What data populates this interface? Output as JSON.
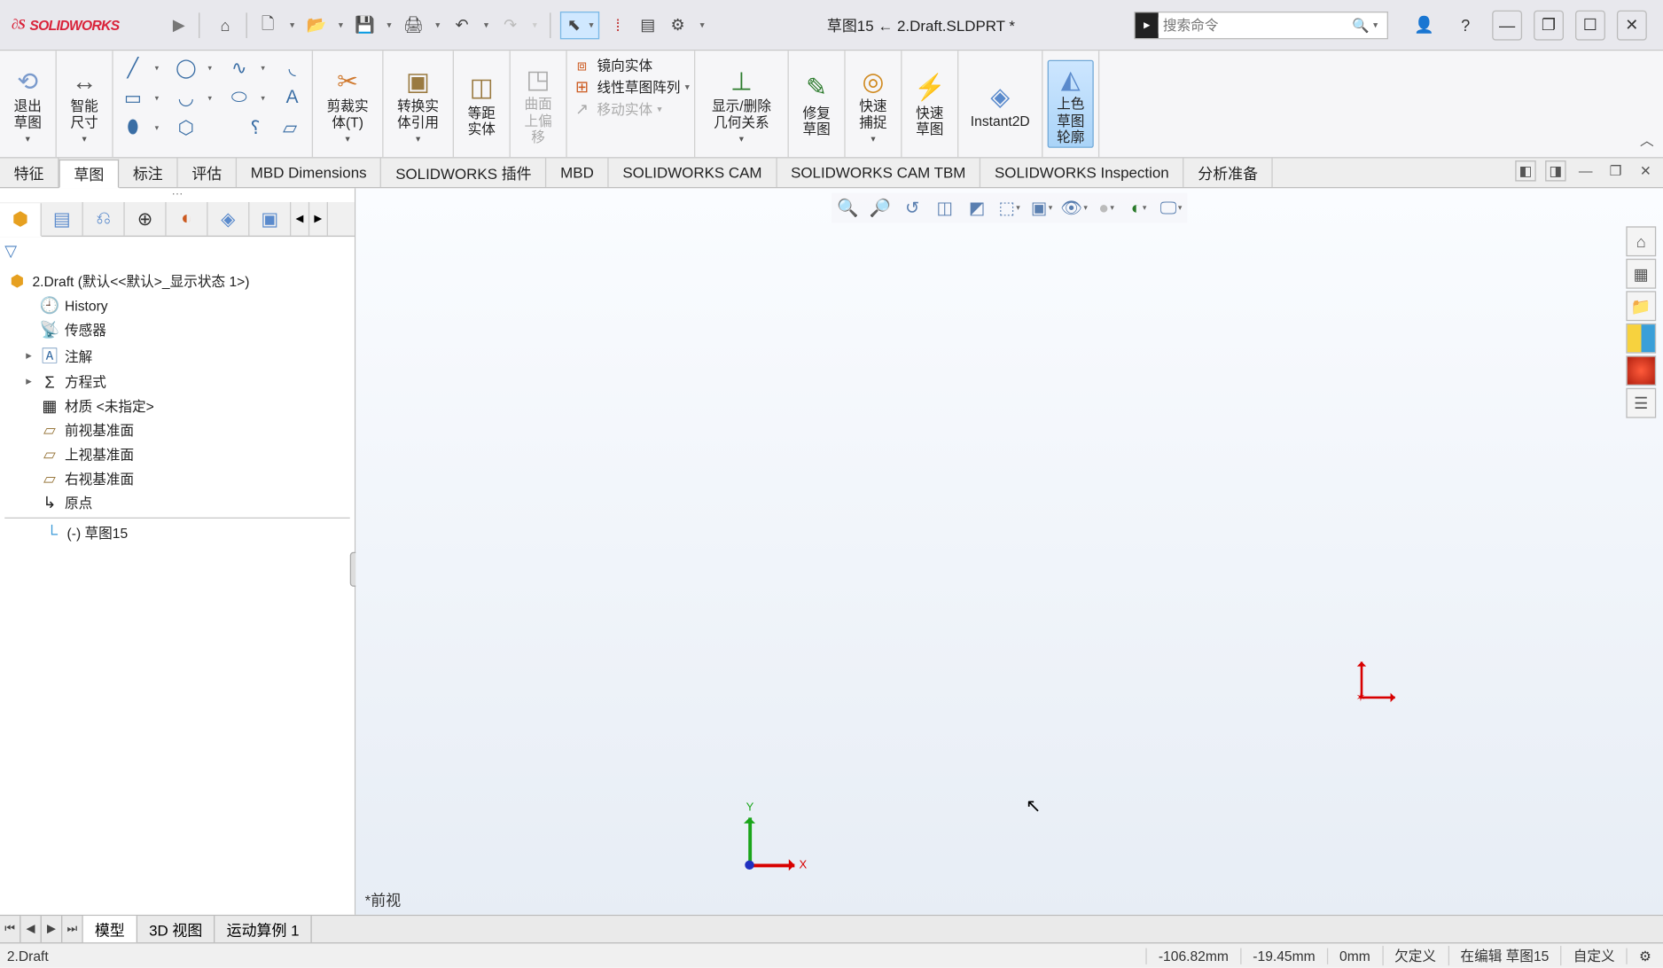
{
  "titlebar": {
    "logo_text": "SOLIDWORKS",
    "doc_title": "草图15 ← 2.Draft.SLDPRT *",
    "search_placeholder": "搜索命令"
  },
  "ribbon": {
    "exit_sketch": "退出\n草图",
    "smart_dim": "智能\n尺寸",
    "trim": "剪裁实\n体(T)",
    "convert": "转换实\n体引用",
    "offset": "等距\n实体",
    "surface_offset": "曲面\n上偏\n移",
    "mirror": "镜向实体",
    "linear_pattern": "线性草图阵列",
    "move": "移动实体",
    "show_del_rel": "显示/删除\n几何关系",
    "repair_sketch": "修复\n草图",
    "quick_snap": "快速\n捕捉",
    "quick_sketch": "快速\n草图",
    "instant2d": "Instant2D",
    "shade_outline": "上色\n草图\n轮廓"
  },
  "cm_tabs": [
    "特征",
    "草图",
    "标注",
    "评估",
    "MBD Dimensions",
    "SOLIDWORKS 插件",
    "MBD",
    "SOLIDWORKS CAM",
    "SOLIDWORKS CAM TBM",
    "SOLIDWORKS Inspection",
    "分析准备"
  ],
  "cm_active_index": 1,
  "tree": {
    "root": "2.Draft  (默认<<默认>_显示状态 1>)",
    "items": [
      {
        "icon": "🕘",
        "label": "History"
      },
      {
        "icon": "📡",
        "label": "传感器"
      },
      {
        "icon": "🄰",
        "label": "注解",
        "expandable": true
      },
      {
        "icon": "Σ",
        "label": "方程式",
        "expandable": true
      },
      {
        "icon": "▦",
        "label": "材质 <未指定>"
      },
      {
        "icon": "▱",
        "label": "前视基准面"
      },
      {
        "icon": "▱",
        "label": "上视基准面"
      },
      {
        "icon": "▱",
        "label": "右视基准面"
      },
      {
        "icon": "↳",
        "label": "原点"
      }
    ],
    "sketch_item": "(-) 草图15"
  },
  "viewport": {
    "orientation_label": "*前视",
    "triad_y": "Y",
    "triad_x": "X"
  },
  "bottom_tabs": {
    "tabs": [
      "模型",
      "3D 视图",
      "运动算例 1"
    ],
    "active_index": 0
  },
  "status": {
    "left": "2.Draft",
    "coord_x": "-106.82mm",
    "coord_y": "-19.45mm",
    "coord_z": "0mm",
    "defined": "欠定义",
    "editing": "在编辑 草图15",
    "custom": "自定义"
  }
}
